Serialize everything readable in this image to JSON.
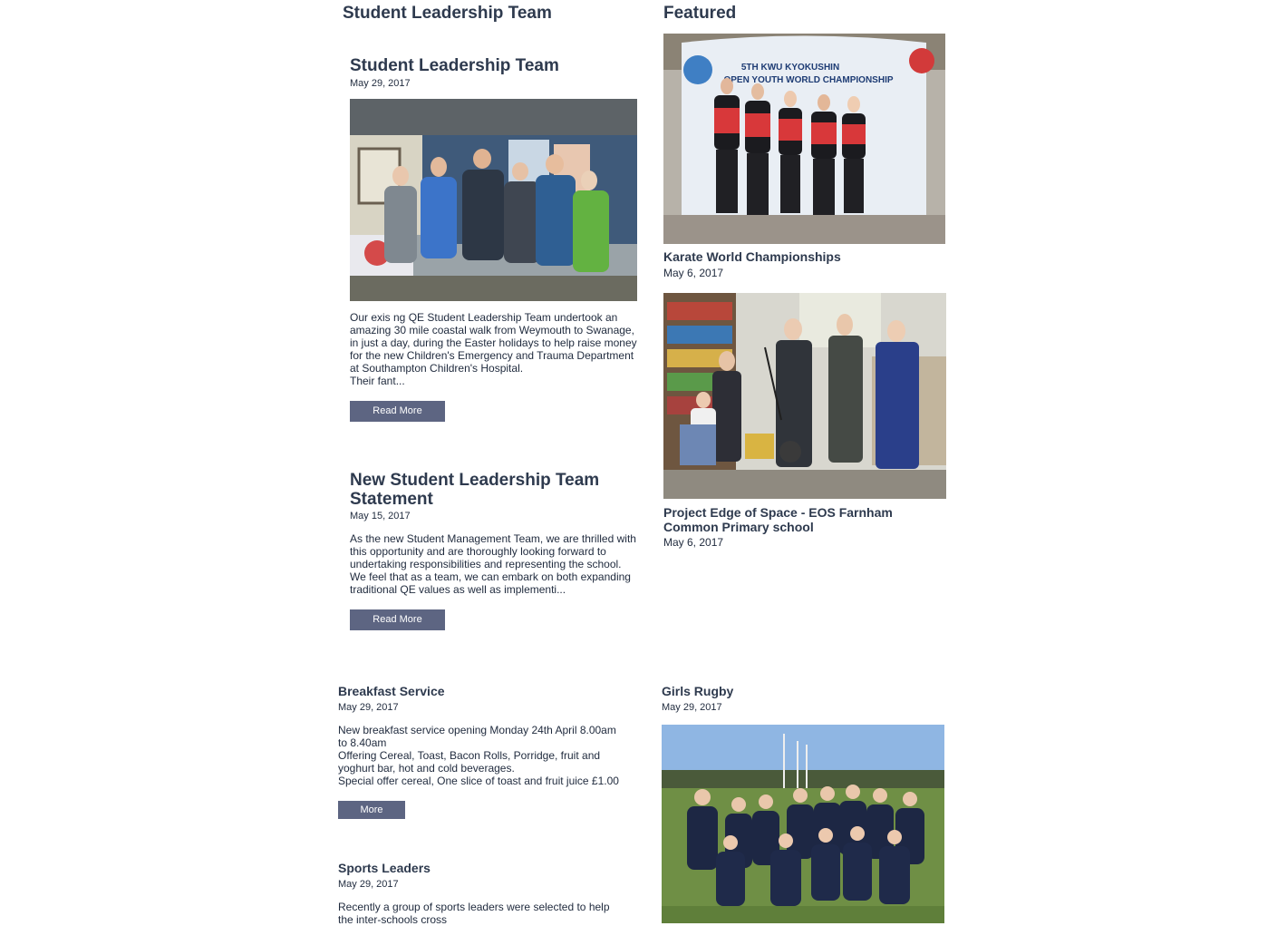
{
  "left_section": {
    "heading": "Student Leadership Team"
  },
  "featured_section": {
    "heading": "Featured"
  },
  "posts": [
    {
      "title": "Student Leadership Team",
      "date": "May 29, 2017",
      "excerpt": "Our exis ng QE Student Leadership Team undertook an\namazing 30 mile coastal walk from Weymouth to Swanage,\nin just a day, during the Easter holidays to help raise money\nfor the new Children's Emergency and Trauma Department\nat Southampton Children's Hospital.\nTheir fant...",
      "button": "Read More"
    },
    {
      "title_line1": "New Student Leadership Team",
      "title_line2": "Statement",
      "date": "May 15, 2017",
      "excerpt": "As the new Student Management Team, we are thrilled with\nthis opportunity and are thoroughly looking forward to\nundertaking responsibilities and representing the school.\nWe feel that as a team, we can embark on both expanding\ntraditional QE values as well as implementi...",
      "button": "Read More"
    }
  ],
  "featured": [
    {
      "title": "Karate World Championships",
      "date": "May 6, 2017",
      "banner_line1": "5TH KWU KYOKUSHIN",
      "banner_line2": "OPEN YOUTH WORLD CHAMPIONSHIP"
    },
    {
      "title_line1": "Project Edge of Space - EOS Farnham",
      "title_line2": "Common Primary school",
      "date": "May 6, 2017"
    }
  ],
  "breakfast": {
    "title": "Breakfast Service",
    "date": "May 29, 2017",
    "text": "New breakfast service opening Monday 24th April 8.00am\nto 8.40am\nOffering Cereal, Toast, Bacon Rolls, Porridge, fruit and\nyoghurt bar, hot and cold beverages.\nSpecial offer cereal, One slice of toast and fruit juice £1.00",
    "button": "More"
  },
  "sports": {
    "title": "Sports Leaders",
    "date": "May 29, 2017",
    "text": "Recently a group of sports leaders were selected to help\nthe inter-schools cross"
  },
  "rugby": {
    "title": "Girls Rugby",
    "date": "May 29, 2017"
  },
  "colors": {
    "button_bg": "#5d6582",
    "heading": "#2e3a4e",
    "text": "#1f2a3d"
  }
}
